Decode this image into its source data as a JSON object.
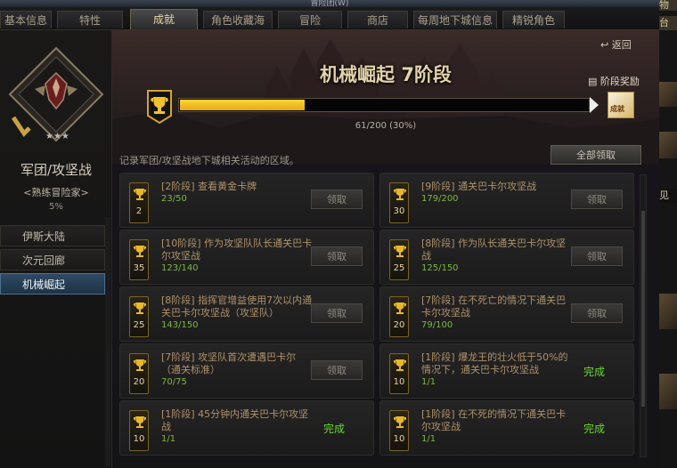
{
  "window": {
    "title": "冒险团(W)"
  },
  "tabs": [
    {
      "label": "基本信息",
      "active": false
    },
    {
      "label": "特性",
      "active": false
    },
    {
      "label": "成就",
      "active": true
    },
    {
      "label": "角色收藏海",
      "active": false
    },
    {
      "label": "冒险",
      "active": false
    },
    {
      "label": "商店",
      "active": false
    },
    {
      "label": "每周地下城信息",
      "active": false
    },
    {
      "label": "精锐角色",
      "active": false
    }
  ],
  "right_frame": {
    "labels": [
      "物",
      "台",
      "见措"
    ]
  },
  "left": {
    "category_title": "军团/攻坚战",
    "rank": "<熟练冒险家>",
    "percent": "5%",
    "nav": [
      {
        "label": "伊斯大陆",
        "active": false
      },
      {
        "label": "次元回廊",
        "active": false
      },
      {
        "label": "机械崛起",
        "active": true
      }
    ]
  },
  "main": {
    "back": "返回",
    "stage_title": "机械崛起 7阶段",
    "stage_reward_label": "阶段奖励",
    "reward_icon_text": "成就",
    "progress": {
      "current": 61,
      "total": 200,
      "text": "61/200 (30%)",
      "fraction": 0.305
    },
    "description": "记录军团/攻坚战地下城相关活动的区域。",
    "claim_all": "全部领取",
    "claim_label": "领取",
    "complete_label": "完成",
    "colors": {
      "accent": "#f2c12e",
      "complete": "#67d832",
      "progress": "#79b83d"
    }
  },
  "achievements": [
    {
      "level": "2",
      "title": "[2阶段] 查看黄金卡牌",
      "progress": "23/50",
      "status": "claim"
    },
    {
      "level": "30",
      "title": "[9阶段] 通关巴卡尔攻坚战",
      "progress": "179/200",
      "status": "claim"
    },
    {
      "level": "35",
      "title": "[10阶段] 作为攻坚队队长通关巴卡尔攻坚战",
      "progress": "123/140",
      "status": "claim"
    },
    {
      "level": "25",
      "title": "[8阶段] 作为队长通关巴卡尔攻坚战",
      "progress": "125/150",
      "status": "claim"
    },
    {
      "level": "25",
      "title": "[8阶段] 指挥官增益使用7次以内通关巴卡尔攻坚战（攻坚队）",
      "progress": "143/150",
      "status": "claim"
    },
    {
      "level": "20",
      "title": "[7阶段] 在不死亡的情况下通关巴卡尔攻坚战",
      "progress": "79/100",
      "status": "claim"
    },
    {
      "level": "20",
      "title": "[7阶段] 攻坚队首次遭遇巴卡尔（通关标准）",
      "progress": "70/75",
      "status": "claim"
    },
    {
      "level": "10",
      "title": "[1阶段] 爆龙王的壮火低于50%的情况下，通关巴卡尔攻坚战",
      "progress": "1/1",
      "status": "complete"
    },
    {
      "level": "10",
      "title": "[1阶段] 45分钟内通关巴卡尔攻坚战",
      "progress": "1/1",
      "status": "complete"
    },
    {
      "level": "10",
      "title": "[1阶段] 在不死的情况下通关巴卡尔攻坚战",
      "progress": "1/1",
      "status": "complete"
    }
  ]
}
